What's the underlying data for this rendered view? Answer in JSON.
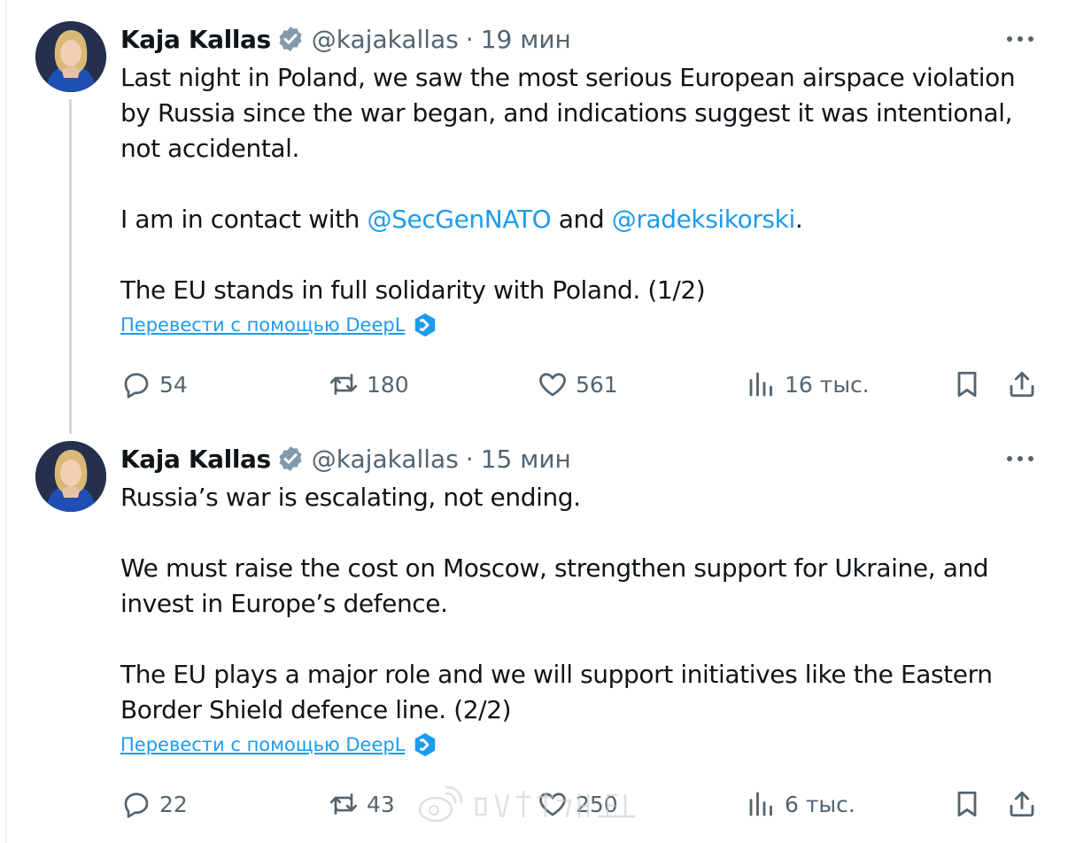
{
  "tweets": [
    {
      "author_name": "Kaja Kallas",
      "handle": "@kajakallas",
      "separator": "·",
      "time": "19 мин",
      "body": {
        "paragraph_1": "Last night in Poland, we saw the most serious European airspace violation by Russia since the war began, and indications suggest it was intentional, not accidental.",
        "contact_prefix": "I am in contact with ",
        "mention_1": "@SecGenNATO",
        "contact_middle": " and ",
        "mention_2": "@radeksikorski",
        "contact_suffix": ".",
        "paragraph_3": "The EU stands in full solidarity with Poland. (1/2)"
      },
      "translate_label": "Перевести с помощью DeepL",
      "stats": {
        "replies": "54",
        "reposts": "180",
        "likes": "561",
        "views": "16 тыс."
      }
    },
    {
      "author_name": "Kaja Kallas",
      "handle": "@kajakallas",
      "separator": "·",
      "time": "15 мин",
      "body": {
        "paragraph_1": "Russia’s war is escalating, not ending.",
        "paragraph_2": "We must raise the cost on Moscow, strengthen support for Ukraine, and invest in Europe’s defence.",
        "paragraph_3": "The EU plays a major role and we will support initiatives like the Eastern Border Shield defence line. (2/2)"
      },
      "translate_label": "Перевести с помощью DeepL",
      "stats": {
        "replies": "22",
        "reposts": "43",
        "likes": "250",
        "views": "6 тыс."
      }
    }
  ],
  "colors": {
    "text": "#0f1419",
    "secondary": "#536471",
    "link": "#1d9bf0",
    "verified": "#829aab",
    "thread_line": "#cfd9de"
  },
  "icons": {
    "verified": "verified-badge-icon",
    "more": "more-options-icon",
    "translate": "deepl-icon",
    "reply": "reply-icon",
    "repost": "repost-icon",
    "like": "heart-icon",
    "views": "views-chart-icon",
    "bookmark": "bookmark-icon",
    "share": "share-icon",
    "watermark_logo": "weibo-logo-icon"
  },
  "watermark": {
    "text": "@沙姆雄狮_EL"
  }
}
